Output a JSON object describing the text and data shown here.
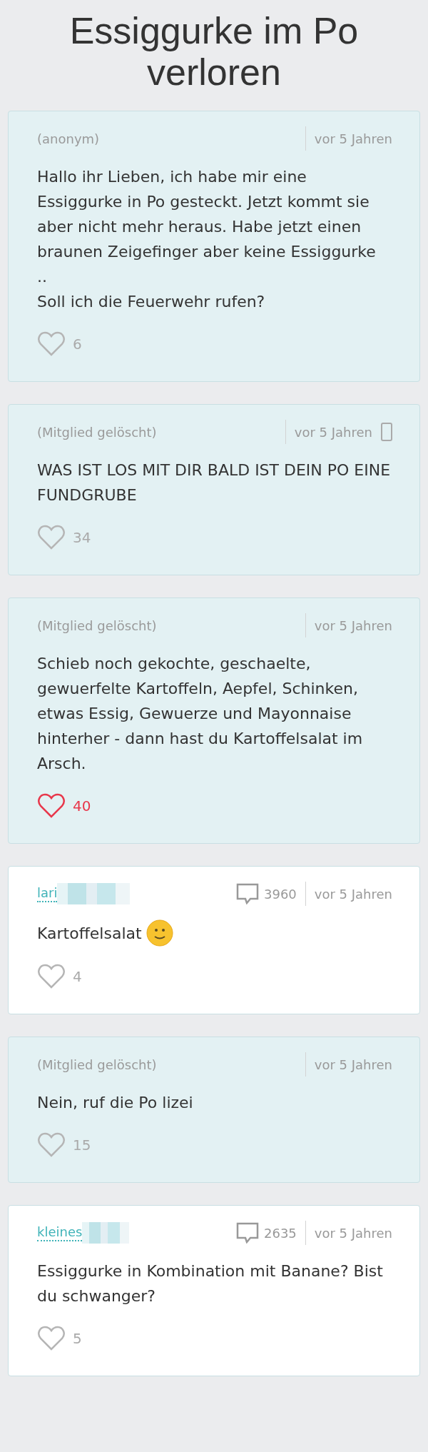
{
  "title": "Essiggurke im Po verloren",
  "posts": [
    {
      "kind": "guest",
      "author": "(anonym)",
      "time": "vor 5 Jahren",
      "mobile": false,
      "text": "Hallo ihr Lieben, ich habe mir eine Essiggurke in Po gesteckt. Jetzt kommt sie aber nicht mehr heraus. Habe jetzt einen braunen Zeigefinger aber keine Essiggurke\n..\nSoll ich die Feuerwehr rufen?",
      "emoji": false,
      "liked": false,
      "likes": "6"
    },
    {
      "kind": "guest",
      "author": "(Mitglied gelöscht)",
      "time": "vor 5 Jahren",
      "mobile": true,
      "text": "WAS IST LOS MIT DIR BALD IST DEIN PO EINE FUNDGRUBE",
      "emoji": false,
      "liked": false,
      "likes": "34"
    },
    {
      "kind": "guest",
      "author": "(Mitglied gelöscht)",
      "time": "vor 5 Jahren",
      "mobile": false,
      "text": "Schieb noch gekochte, geschaelte, gewuerfelte Kartoffeln, Aepfel, Schinken, etwas Essig, Gewuerze und Mayonnaise hinterher - dann hast du Kartoffelsalat im Arsch.",
      "emoji": false,
      "liked": true,
      "likes": "40"
    },
    {
      "kind": "member",
      "author": "lari",
      "redacted": true,
      "comments": "3960",
      "time": "vor 5 Jahren",
      "mobile": false,
      "text": "Kartoffelsalat",
      "emoji": true,
      "liked": false,
      "likes": "4"
    },
    {
      "kind": "guest",
      "author": "(Mitglied gelöscht)",
      "time": "vor 5 Jahren",
      "mobile": false,
      "text": "Nein, ruf die Po lizei",
      "emoji": false,
      "liked": false,
      "likes": "15"
    },
    {
      "kind": "member",
      "author": "kleines",
      "redacted": true,
      "comments": "2635",
      "time": "vor 5 Jahren",
      "mobile": false,
      "text": "Essiggurke in Kombination mit Banane? Bist du schwanger?",
      "emoji": false,
      "liked": false,
      "likes": "5"
    }
  ]
}
